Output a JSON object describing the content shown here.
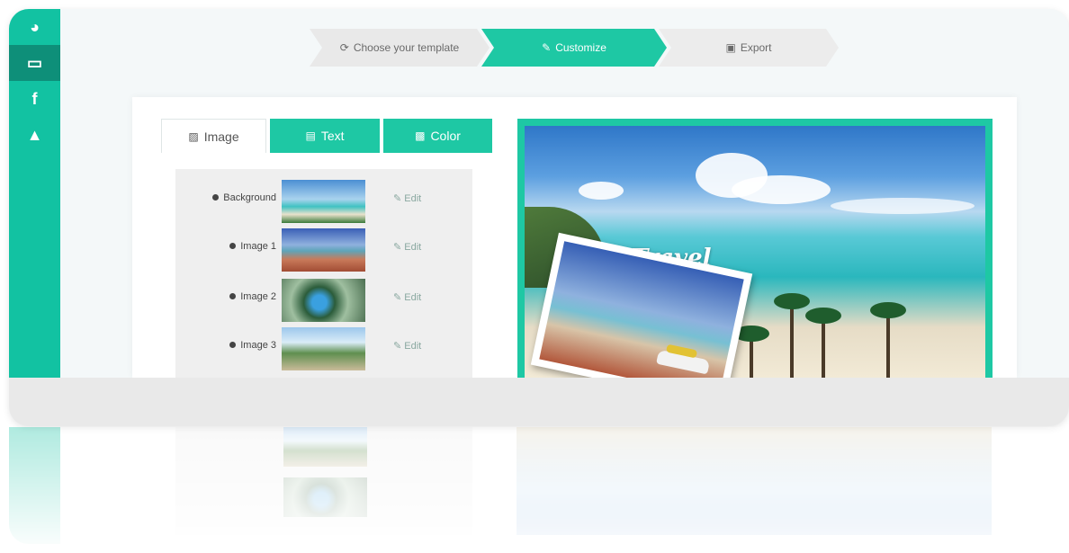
{
  "sidebar": {
    "items": [
      {
        "icon": "dashboard-icon",
        "glyph": "◕"
      },
      {
        "icon": "laptop-icon",
        "glyph": "▭"
      },
      {
        "icon": "facebook-icon",
        "glyph": "f"
      },
      {
        "icon": "graduation-cap-icon",
        "glyph": "▲"
      }
    ]
  },
  "steps": [
    {
      "label": "Choose your template",
      "icon": "template-icon",
      "glyph": "⟳"
    },
    {
      "label": "Customize",
      "icon": "edit-icon",
      "glyph": "✎"
    },
    {
      "label": "Export",
      "icon": "export-icon",
      "glyph": "▣"
    }
  ],
  "tabs": [
    {
      "label": "Image",
      "icon": "image-icon",
      "glyph": "▨"
    },
    {
      "label": "Text",
      "icon": "text-icon",
      "glyph": "▤"
    },
    {
      "label": "Color",
      "icon": "color-icon",
      "glyph": "▩"
    }
  ],
  "images": [
    {
      "label": "Background",
      "edit": "Edit"
    },
    {
      "label": "Image 1",
      "edit": "Edit"
    },
    {
      "label": "Image 2",
      "edit": "Edit"
    },
    {
      "label": "Image 3",
      "edit": "Edit"
    }
  ],
  "preview": {
    "title": "Travel"
  },
  "colors": {
    "accent": "#1ec8a4",
    "sidebar": "#12c2a2",
    "sidebar_active": "#0e8f79"
  }
}
